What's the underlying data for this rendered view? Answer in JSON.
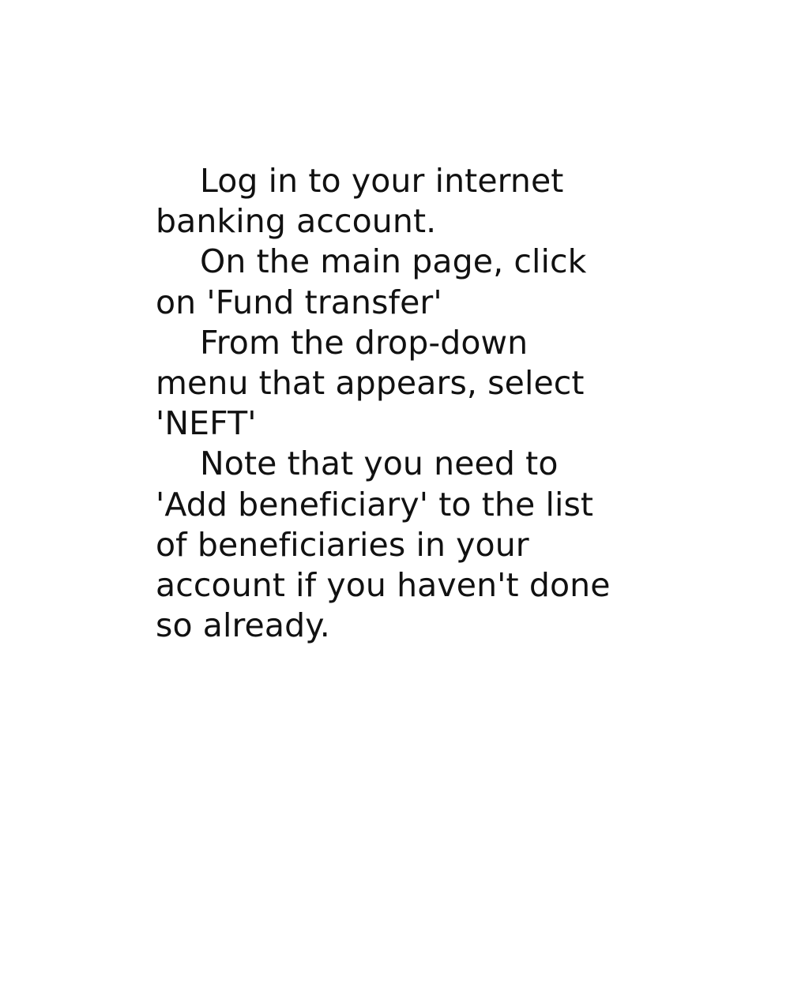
{
  "steps": [
    "Log in to your internet banking account.",
    "On the main page, click on 'Fund transfer'",
    "From the drop-down menu that appears, select 'NEFT'",
    "Note that you need to 'Add beneficiary' to the list of beneficiaries in your account if you haven't done so already."
  ]
}
